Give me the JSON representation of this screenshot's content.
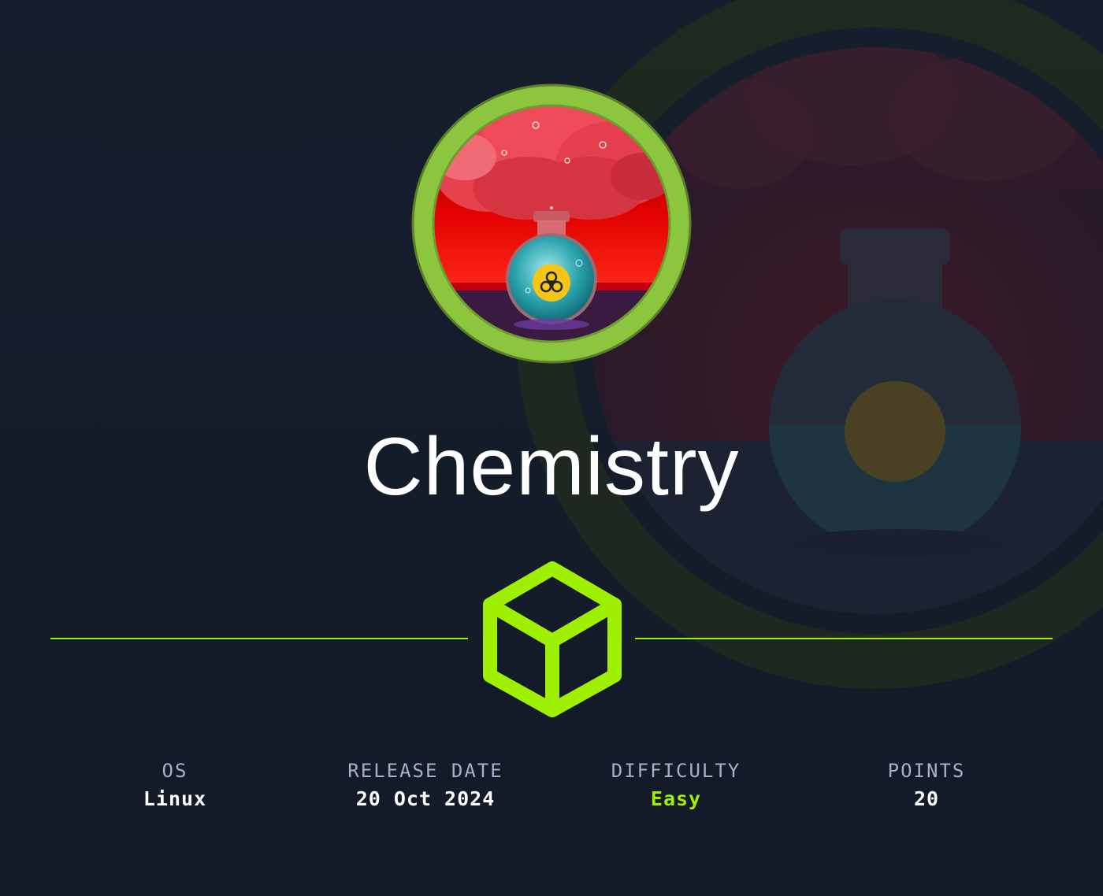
{
  "machine": {
    "name": "Chemistry",
    "avatar_icon": "chemistry-flask-avatar",
    "logo_icon": "htb-cube-icon"
  },
  "stats": {
    "os": {
      "label": "OS",
      "value": "Linux"
    },
    "release_date": {
      "label": "RELEASE DATE",
      "value": "20 Oct 2024"
    },
    "difficulty": {
      "label": "DIFFICULTY",
      "value": "Easy"
    },
    "points": {
      "label": "POINTS",
      "value": "20"
    }
  },
  "colors": {
    "background": "#141b28",
    "accent": "#9fef00",
    "label": "#a4b1cd",
    "value": "#ffffff"
  }
}
